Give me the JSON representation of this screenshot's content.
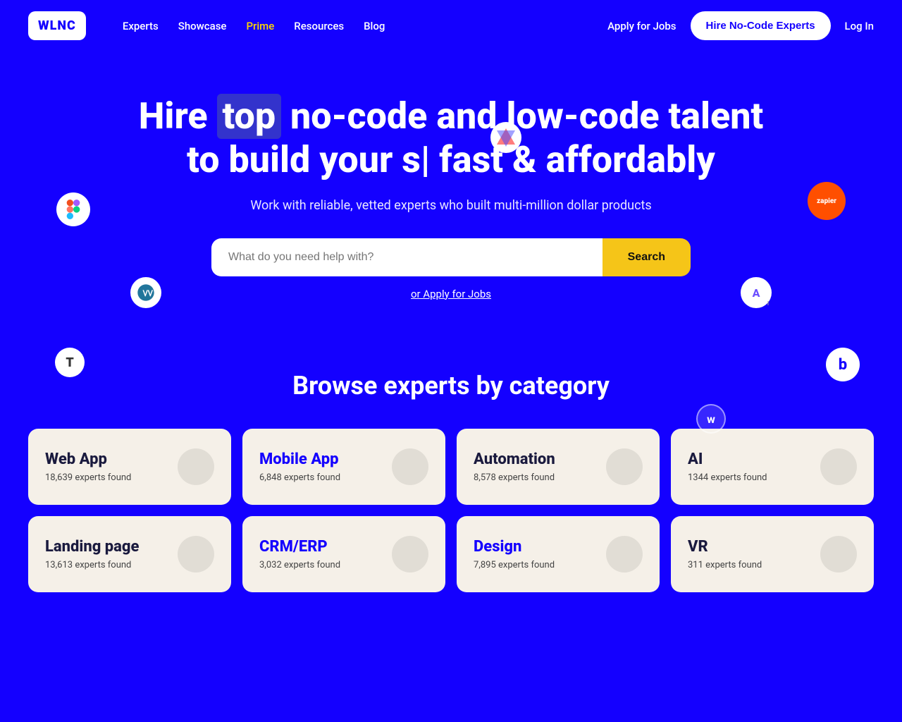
{
  "logo": "WLNC",
  "nav": {
    "links": [
      {
        "label": "Experts",
        "href": "#",
        "class": ""
      },
      {
        "label": "Showcase",
        "href": "#",
        "class": ""
      },
      {
        "label": "Prime",
        "href": "#",
        "class": "prime"
      },
      {
        "label": "Resources",
        "href": "#",
        "class": ""
      },
      {
        "label": "Blog",
        "href": "#",
        "class": ""
      }
    ],
    "apply_label": "Apply for Jobs",
    "hire_label": "Hire No-Code Experts",
    "login_label": "Log In"
  },
  "hero": {
    "headline_before": "Hire ",
    "headline_highlight": "top",
    "headline_after": " no-code and low-code talent to build your s| fast & affordably",
    "subtitle": "Work with reliable, vetted experts who built multi-million dollar products",
    "search_placeholder": "What do you need help with?",
    "search_button": "Search",
    "apply_link": "or Apply for Jobs"
  },
  "browse": {
    "title": "Browse experts by category",
    "categories": [
      {
        "name": "Web App",
        "count": "18,639 experts found"
      },
      {
        "name": "Mobile App",
        "count": "6,848 experts found"
      },
      {
        "name": "Automation",
        "count": "8,578 experts found"
      },
      {
        "name": "AI",
        "count": "1344 experts found"
      },
      {
        "name": "Landing page",
        "count": "13,613 experts found"
      },
      {
        "name": "CRM/ERP",
        "count": "3,032 experts found"
      },
      {
        "name": "Design",
        "count": "7,895 experts found"
      },
      {
        "name": "VR",
        "count": "311 experts found"
      }
    ]
  },
  "floating_icons": {
    "figma": "F",
    "zapier": "zapier",
    "wordpress": "W",
    "adalo": "A",
    "tt": "T",
    "bubble": "b",
    "webflow": "w",
    "multicolor": "★"
  }
}
